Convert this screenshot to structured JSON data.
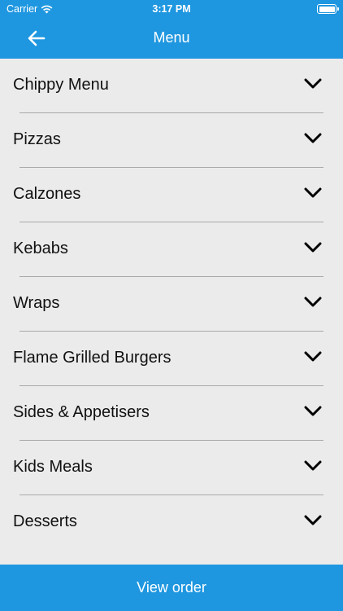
{
  "status": {
    "carrier": "Carrier",
    "time": "3:17 PM"
  },
  "nav": {
    "title": "Menu",
    "back_icon": "arrow-left-icon"
  },
  "menu": {
    "items": [
      {
        "label": "Chippy Menu"
      },
      {
        "label": "Pizzas"
      },
      {
        "label": "Calzones"
      },
      {
        "label": "Kebabs"
      },
      {
        "label": "Wraps"
      },
      {
        "label": "Flame Grilled Burgers"
      },
      {
        "label": "Sides & Appetisers"
      },
      {
        "label": "Kids Meals"
      },
      {
        "label": "Desserts"
      }
    ]
  },
  "footer": {
    "button_label": "View order"
  },
  "colors": {
    "accent": "#1f97e0",
    "background": "#ebebeb",
    "divider": "#a9a9a9"
  }
}
